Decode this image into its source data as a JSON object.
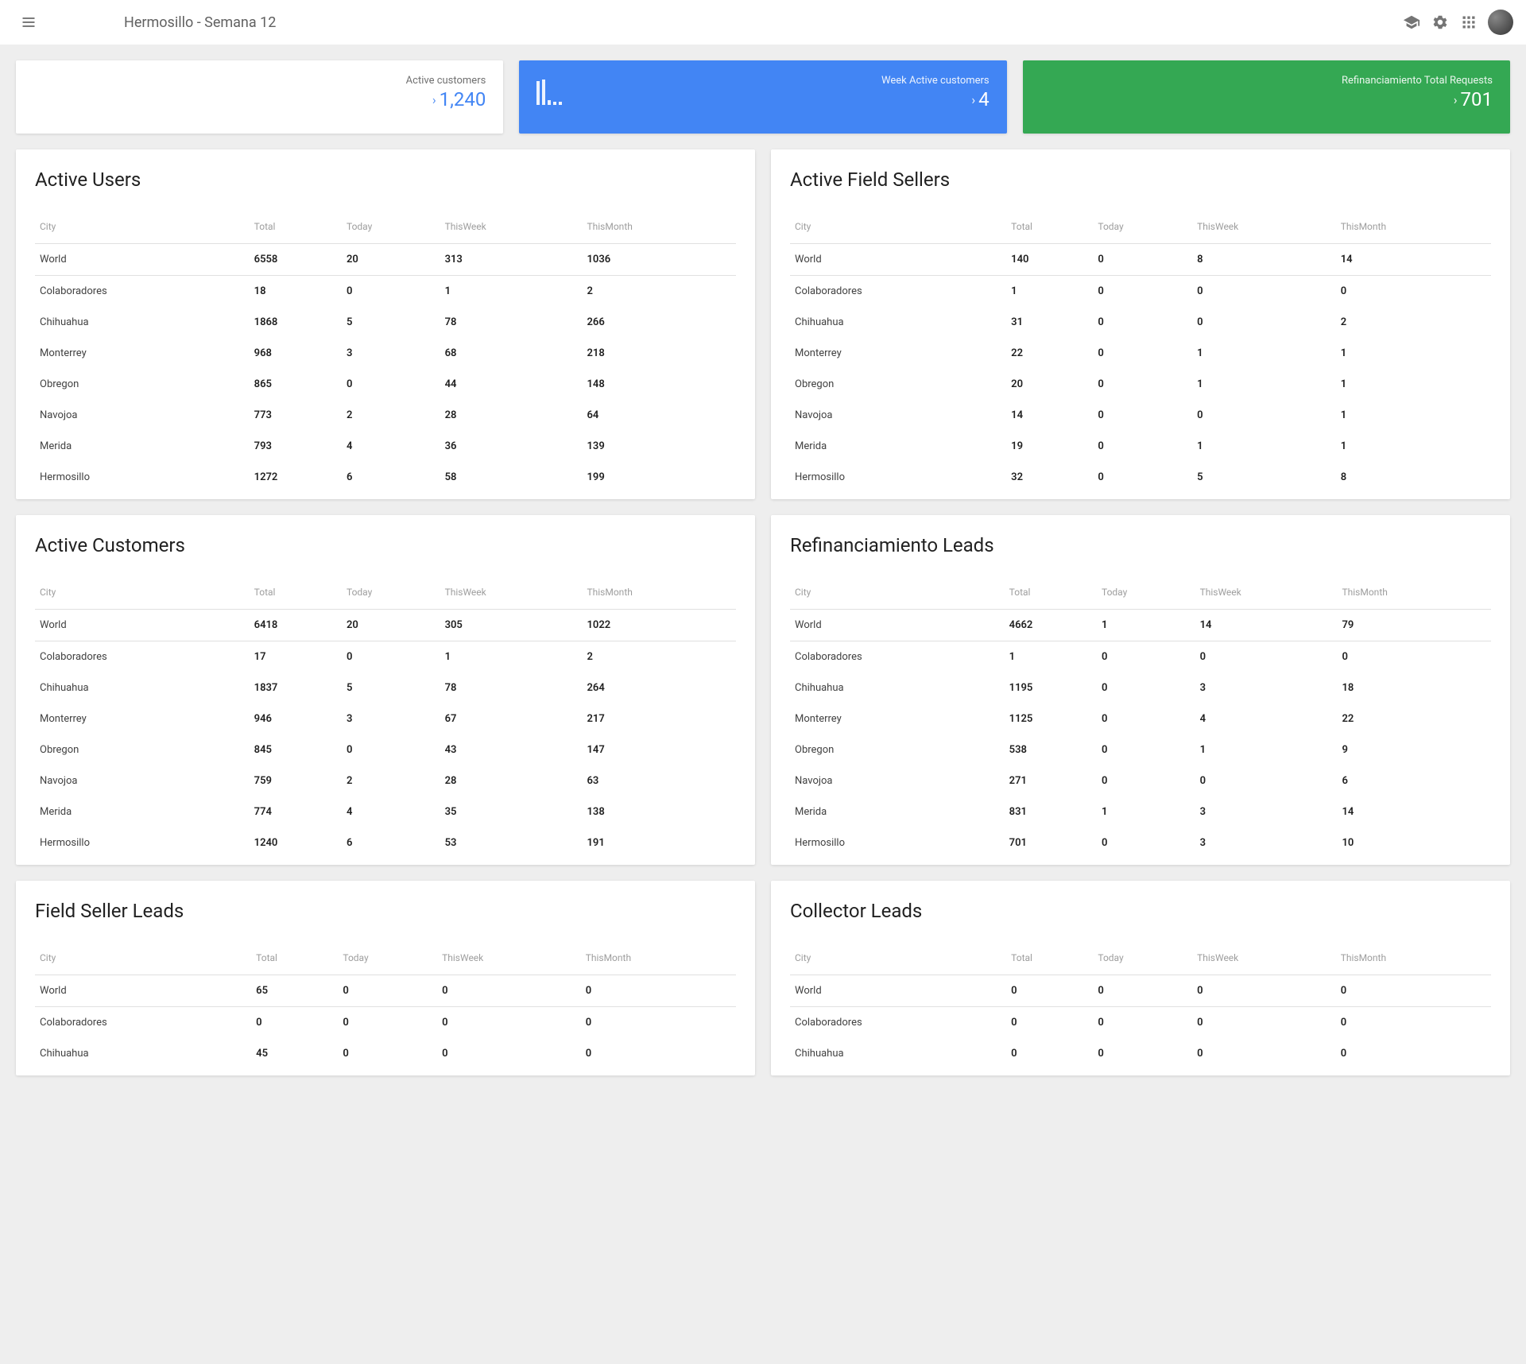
{
  "header": {
    "title": "Hermosillo - Semana 12"
  },
  "kpis": [
    {
      "label": "Active customers",
      "value": "1,240",
      "style": "white"
    },
    {
      "label": "Week Active customers",
      "value": "4",
      "style": "blue",
      "bars": [
        30,
        32,
        6,
        4,
        4
      ]
    },
    {
      "label": "Refinanciamiento Total Requests",
      "value": "701",
      "style": "green"
    }
  ],
  "columns": [
    "City",
    "Total",
    "Today",
    "ThisWeek",
    "ThisMonth"
  ],
  "panels": [
    {
      "title": "Active Users",
      "rows": [
        [
          "World",
          "6558",
          "20",
          "313",
          "1036"
        ],
        [
          "Colaboradores",
          "18",
          "0",
          "1",
          "2"
        ],
        [
          "Chihuahua",
          "1868",
          "5",
          "78",
          "266"
        ],
        [
          "Monterrey",
          "968",
          "3",
          "68",
          "218"
        ],
        [
          "Obregon",
          "865",
          "0",
          "44",
          "148"
        ],
        [
          "Navojoa",
          "773",
          "2",
          "28",
          "64"
        ],
        [
          "Merida",
          "793",
          "4",
          "36",
          "139"
        ],
        [
          "Hermosillo",
          "1272",
          "6",
          "58",
          "199"
        ]
      ]
    },
    {
      "title": "Active Field Sellers",
      "rows": [
        [
          "World",
          "140",
          "0",
          "8",
          "14"
        ],
        [
          "Colaboradores",
          "1",
          "0",
          "0",
          "0"
        ],
        [
          "Chihuahua",
          "31",
          "0",
          "0",
          "2"
        ],
        [
          "Monterrey",
          "22",
          "0",
          "1",
          "1"
        ],
        [
          "Obregon",
          "20",
          "0",
          "1",
          "1"
        ],
        [
          "Navojoa",
          "14",
          "0",
          "0",
          "1"
        ],
        [
          "Merida",
          "19",
          "0",
          "1",
          "1"
        ],
        [
          "Hermosillo",
          "32",
          "0",
          "5",
          "8"
        ]
      ]
    },
    {
      "title": "Active Customers",
      "rows": [
        [
          "World",
          "6418",
          "20",
          "305",
          "1022"
        ],
        [
          "Colaboradores",
          "17",
          "0",
          "1",
          "2"
        ],
        [
          "Chihuahua",
          "1837",
          "5",
          "78",
          "264"
        ],
        [
          "Monterrey",
          "946",
          "3",
          "67",
          "217"
        ],
        [
          "Obregon",
          "845",
          "0",
          "43",
          "147"
        ],
        [
          "Navojoa",
          "759",
          "2",
          "28",
          "63"
        ],
        [
          "Merida",
          "774",
          "4",
          "35",
          "138"
        ],
        [
          "Hermosillo",
          "1240",
          "6",
          "53",
          "191"
        ]
      ]
    },
    {
      "title": "Refinanciamiento Leads",
      "rows": [
        [
          "World",
          "4662",
          "1",
          "14",
          "79"
        ],
        [
          "Colaboradores",
          "1",
          "0",
          "0",
          "0"
        ],
        [
          "Chihuahua",
          "1195",
          "0",
          "3",
          "18"
        ],
        [
          "Monterrey",
          "1125",
          "0",
          "4",
          "22"
        ],
        [
          "Obregon",
          "538",
          "0",
          "1",
          "9"
        ],
        [
          "Navojoa",
          "271",
          "0",
          "0",
          "6"
        ],
        [
          "Merida",
          "831",
          "1",
          "3",
          "14"
        ],
        [
          "Hermosillo",
          "701",
          "0",
          "3",
          "10"
        ]
      ]
    },
    {
      "title": "Field Seller Leads",
      "rows": [
        [
          "World",
          "65",
          "0",
          "0",
          "0"
        ],
        [
          "Colaboradores",
          "0",
          "0",
          "0",
          "0"
        ],
        [
          "Chihuahua",
          "45",
          "0",
          "0",
          "0"
        ]
      ]
    },
    {
      "title": "Collector Leads",
      "rows": [
        [
          "World",
          "0",
          "0",
          "0",
          "0"
        ],
        [
          "Colaboradores",
          "0",
          "0",
          "0",
          "0"
        ],
        [
          "Chihuahua",
          "0",
          "0",
          "0",
          "0"
        ]
      ]
    }
  ]
}
